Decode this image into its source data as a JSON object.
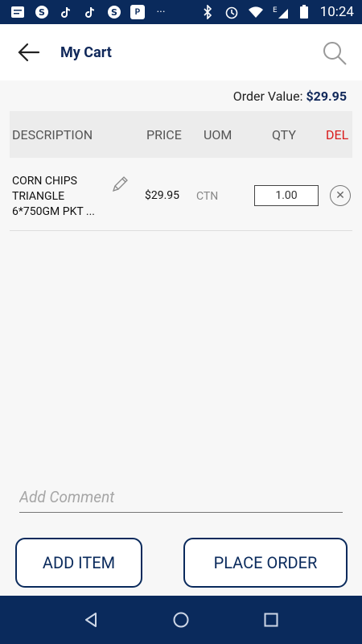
{
  "status_bar": {
    "time": "10:24",
    "carrier_icon": "E",
    "left_icons": [
      "notification-icon",
      "skype-icon",
      "tiktok-icon",
      "tiktok-icon",
      "skype-icon",
      "paytm-icon",
      "more-icon"
    ],
    "right_icons": [
      "bluetooth-icon",
      "alarm-icon",
      "wifi-icon",
      "signal-icon",
      "battery-icon"
    ]
  },
  "header": {
    "title": "My Cart"
  },
  "summary": {
    "label": "Order Value: ",
    "value": "$29.95"
  },
  "table": {
    "columns": {
      "description": "DESCRIPTION",
      "price": "PRICE",
      "uom": "UOM",
      "qty": "QTY",
      "del": "DEL"
    },
    "rows": [
      {
        "description": "CORN CHIPS TRIANGLE 6*750GM PKT ...",
        "price": "$29.95",
        "uom": "CTN",
        "qty": "1.00"
      }
    ]
  },
  "comment": {
    "placeholder": "Add Comment"
  },
  "buttons": {
    "add_item": "ADD ITEM",
    "place_order": "PLACE ORDER"
  },
  "colors": {
    "primary": "#0a2a5c",
    "del_header": "#d91c1c"
  }
}
